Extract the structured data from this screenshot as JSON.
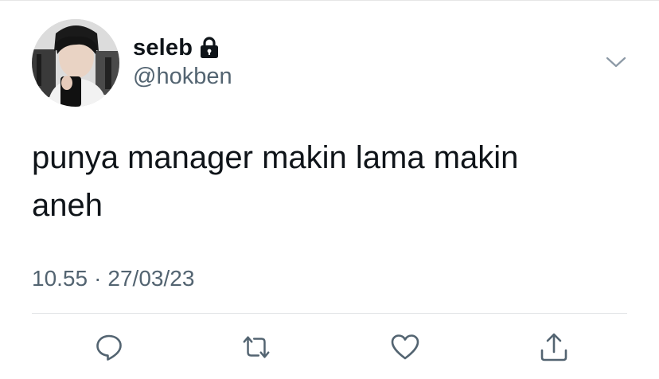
{
  "tweet": {
    "author": {
      "display_name": "seleb",
      "handle": "@hokben",
      "protected_icon": "lock-icon"
    },
    "text_lines": [
      "punya manager makin lama makin",
      "aneh"
    ],
    "time": "10.55",
    "separator": "·",
    "date": "27/03/23"
  },
  "actions": {
    "reply_icon": "reply-icon",
    "retweet_icon": "retweet-icon",
    "like_icon": "heart-icon",
    "share_icon": "share-icon",
    "menu_icon": "chevron-down-icon"
  },
  "colors": {
    "text": "#0f1419",
    "secondary": "#536471",
    "icon": "#536471",
    "divider": "#e1e4e6"
  }
}
